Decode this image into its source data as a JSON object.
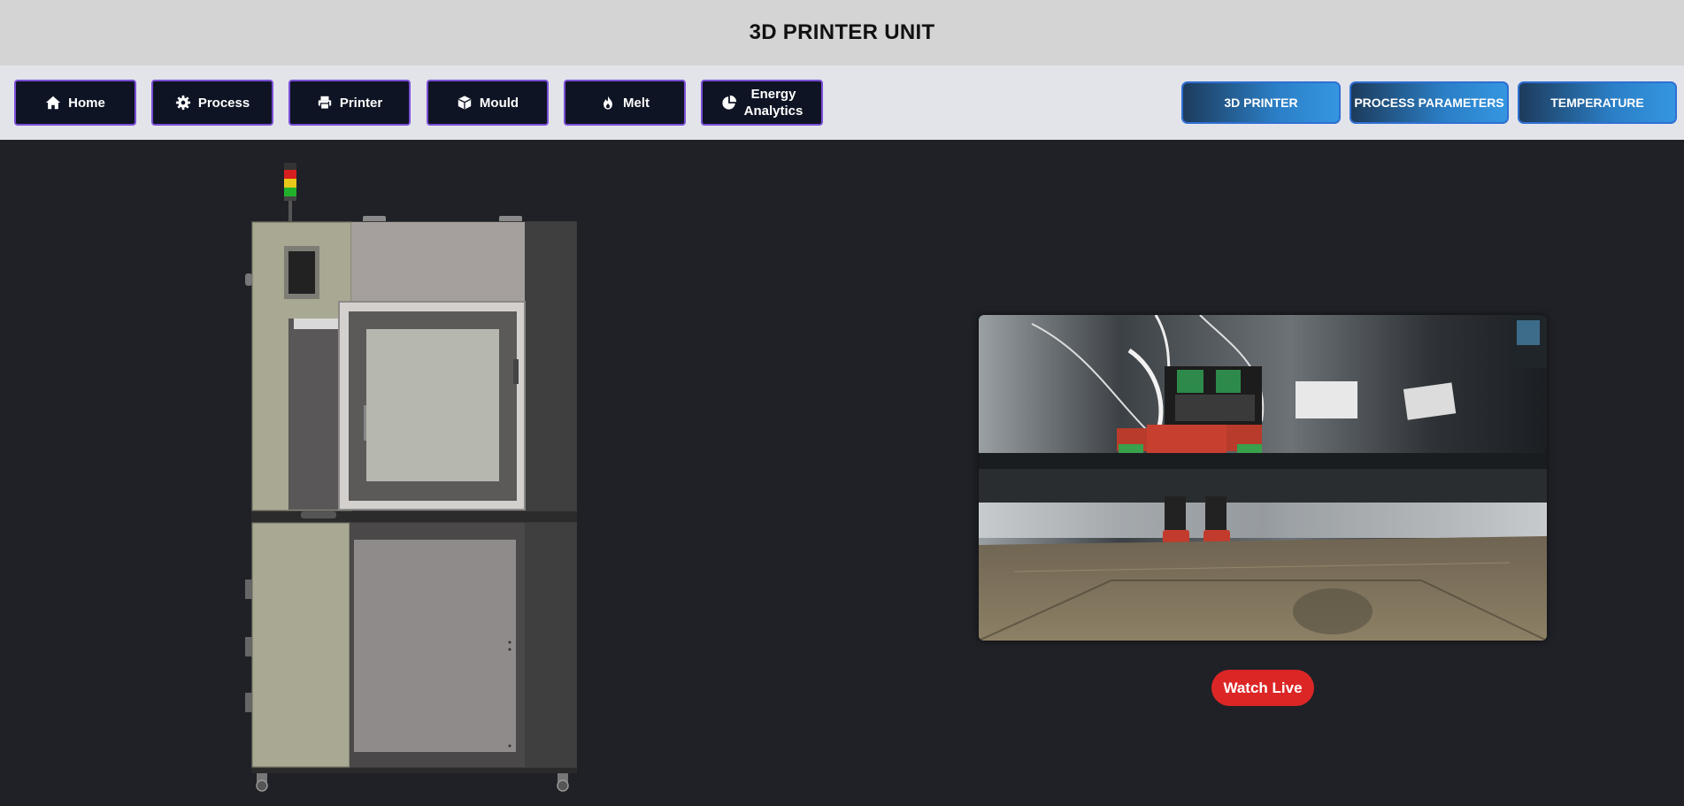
{
  "header": {
    "title": "3D PRINTER UNIT"
  },
  "nav": {
    "items": [
      {
        "label": "Home",
        "icon": "home-icon"
      },
      {
        "label": "Process",
        "icon": "gear-icon"
      },
      {
        "label": "Printer",
        "icon": "printer-icon"
      },
      {
        "label": "Mould",
        "icon": "cube-icon"
      },
      {
        "label": "Melt",
        "icon": "fire-icon"
      },
      {
        "label_line1": "Energy",
        "label_line2": "Analytics",
        "icon": "pie-chart-icon"
      }
    ]
  },
  "tabs": {
    "items": [
      {
        "label": "3D PRINTER"
      },
      {
        "label": "PROCESS PARAMETERS"
      },
      {
        "label": "TEMPERATURE"
      }
    ]
  },
  "video": {
    "button_label": "Watch Live"
  },
  "colors": {
    "background": "#1f2127",
    "header_bg": "#d4d4d4",
    "nav_bg": "#e2e4ea",
    "nav_button_bg": "#0e1424",
    "nav_button_border": "#7a4fd6",
    "tab_gradient_start": "#1d3b5c",
    "tab_gradient_end": "#3596e0",
    "watch_live": "#dc2626"
  }
}
